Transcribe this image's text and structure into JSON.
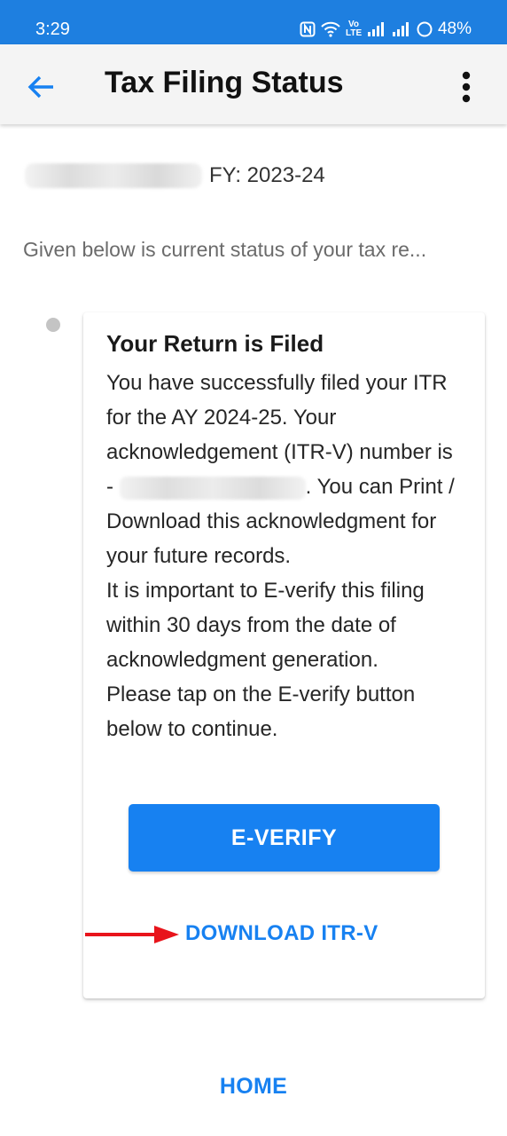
{
  "status_bar": {
    "time": "3:29",
    "volte_label": "Vo\nLTE",
    "battery": "48%",
    "icons": [
      "nfc-icon",
      "wifi-icon",
      "volte-icon",
      "signal-icon",
      "signal-icon",
      "battery-icon"
    ]
  },
  "app_bar": {
    "title": "Tax Filing Status",
    "back_icon": "arrow-left-icon",
    "menu_icon": "more-vert-icon"
  },
  "header": {
    "fy_label": "FY: 2023-24",
    "intro": "Given below is current status of your tax re..."
  },
  "card": {
    "title": "Your Return is Filed",
    "para1_start": "You have successfully filed your ITR for the AY 2024-25. Your acknowledgement (ITR-V) number is - ",
    "para1_end": ". You can Print / Download this acknowledgment for your future records.",
    "para2": "It is important to E-verify this filing within 30 days from the date of acknowledgment generation.",
    "para3": "Please tap on the E-verify button below to continue.",
    "everify_label": "E-VERIFY",
    "download_label": "DOWNLOAD ITR-V"
  },
  "footer": {
    "home_label": "HOME"
  },
  "colors": {
    "status_bar": "#1e7fe0",
    "accent": "#1781f1",
    "annotation_arrow": "#e8141b"
  }
}
